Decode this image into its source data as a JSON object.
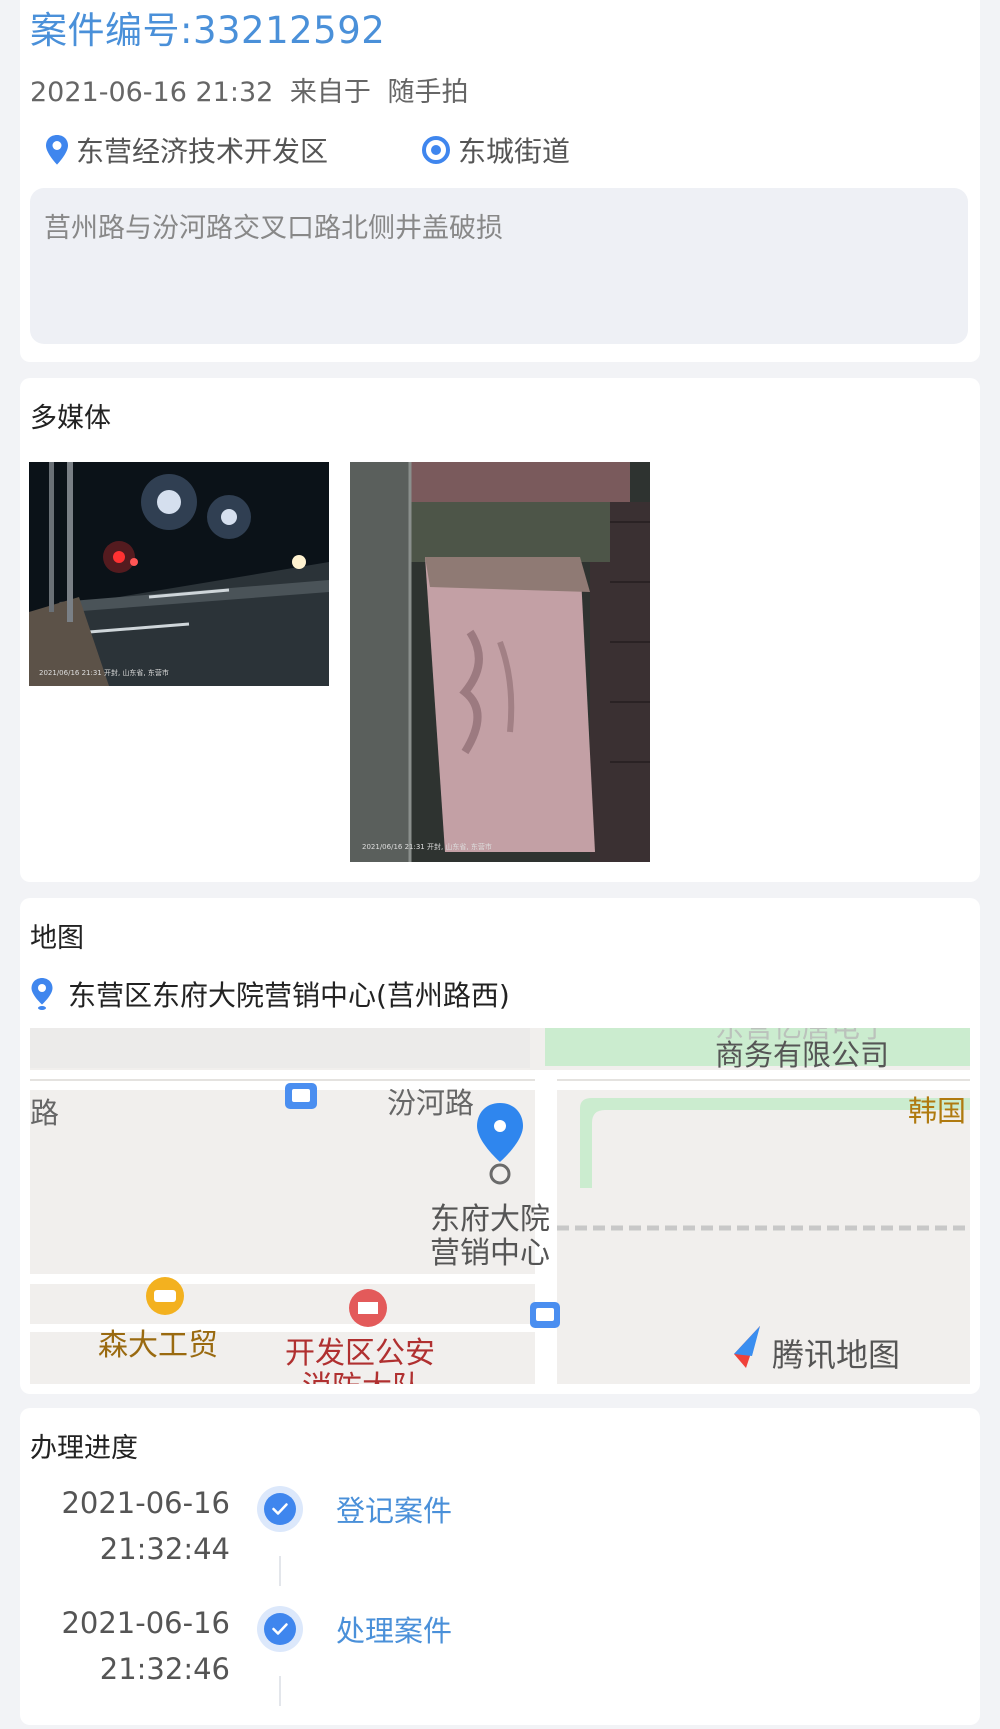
{
  "case": {
    "number": "案件编号:33212592",
    "datetime": "2021-06-16 21:32",
    "source_prefix": "来自于",
    "source": "随手拍",
    "district": "东营经济技术开发区",
    "street": "东城街道",
    "description": "莒州路与汾河路交叉口路北侧井盖破损"
  },
  "media": {
    "title": "多媒体",
    "photos": [
      {
        "stamp": "2021/06/16 21:31 开封, 山东省, 东营市"
      },
      {
        "stamp": "2021/06/16 21:31 开封, 山东省, 东营市"
      }
    ]
  },
  "map": {
    "title": "地图",
    "address": "东营区东府大院营销中心(莒州路西)",
    "labels": {
      "company_line1": "东营亿唐电子",
      "company_line2": "商务有限公司",
      "road_main": "汾河路",
      "road_left": "路",
      "korea": "韩国",
      "poi_line1": "东府大院",
      "poi_line2": "营销中心",
      "sen": "森大工贸",
      "police_line1": "开发区公安",
      "police_line2": "消防大队",
      "brand": "腾讯地图"
    }
  },
  "progress": {
    "title": "办理进度",
    "steps": [
      {
        "date": "2021-06-16",
        "time": "21:32:44",
        "label": "登记案件"
      },
      {
        "date": "2021-06-16",
        "time": "21:32:46",
        "label": "处理案件"
      }
    ]
  },
  "colors": {
    "accent": "#4a90d9",
    "check": "#3f86ee",
    "page_bg": "#f2f3f6"
  }
}
